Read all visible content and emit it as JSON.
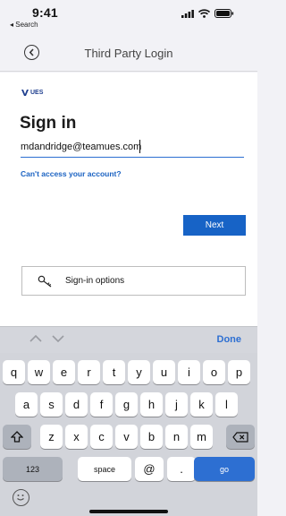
{
  "status_bar": {
    "time": "9:41",
    "back_label": "◂ Search"
  },
  "navbar": {
    "title": "Third Party Login"
  },
  "login": {
    "logo_text": "UES",
    "title": "Sign in",
    "email_value": "mdandridge@teamues.com",
    "cant_access": "Can't access your account?",
    "next_label": "Next",
    "signin_options_label": "Sign-in options"
  },
  "accessory": {
    "done_label": "Done"
  },
  "keyboard": {
    "row1": [
      "q",
      "w",
      "e",
      "r",
      "t",
      "y",
      "u",
      "i",
      "o",
      "p"
    ],
    "row2": [
      "a",
      "s",
      "d",
      "f",
      "g",
      "h",
      "j",
      "k",
      "l"
    ],
    "row3": [
      "z",
      "x",
      "c",
      "v",
      "b",
      "n",
      "m"
    ],
    "numbers_label": "123",
    "space_label": "space",
    "at_label": "@",
    "dot_label": ".",
    "go_label": "go"
  },
  "colors": {
    "accent": "#1763c6",
    "link": "#1a62c2",
    "done": "#2d6fd2"
  }
}
